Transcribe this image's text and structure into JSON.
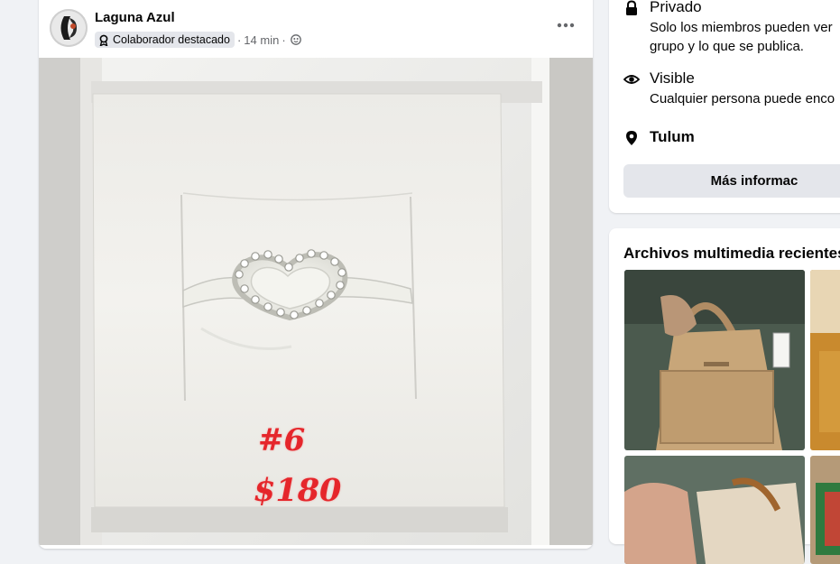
{
  "post": {
    "author": "Laguna Azul",
    "badge": "Colaborador destacado",
    "time": "14 min",
    "separator": "·",
    "photo_caption_1": "#6",
    "photo_caption_2": "$180"
  },
  "about": {
    "privacy_title": "Privado",
    "privacy_desc": "Solo los miembros pueden ver quién está en el grupo y lo que se publica.",
    "privacy_desc_visible": "Solo los miembros pueden ver",
    "privacy_desc_line2": "grupo y lo que se publica.",
    "visible_title": "Visible",
    "visible_desc": "Cualquier persona puede enco",
    "location": "Tulum",
    "more_info_label": "Más informac"
  },
  "media": {
    "title": "Archivos multimedia recientes"
  },
  "icons": {
    "lock": "lock-icon",
    "eye": "eye-icon",
    "location": "location-pin-icon",
    "badge": "award-icon",
    "globe": "globe-icon",
    "more": "more-horizontal-icon"
  },
  "colors": {
    "background": "#f0f2f5",
    "card": "#ffffff",
    "secondary_text": "#65676b",
    "button_bg": "#e4e6eb",
    "price_red": "#e5262b"
  }
}
